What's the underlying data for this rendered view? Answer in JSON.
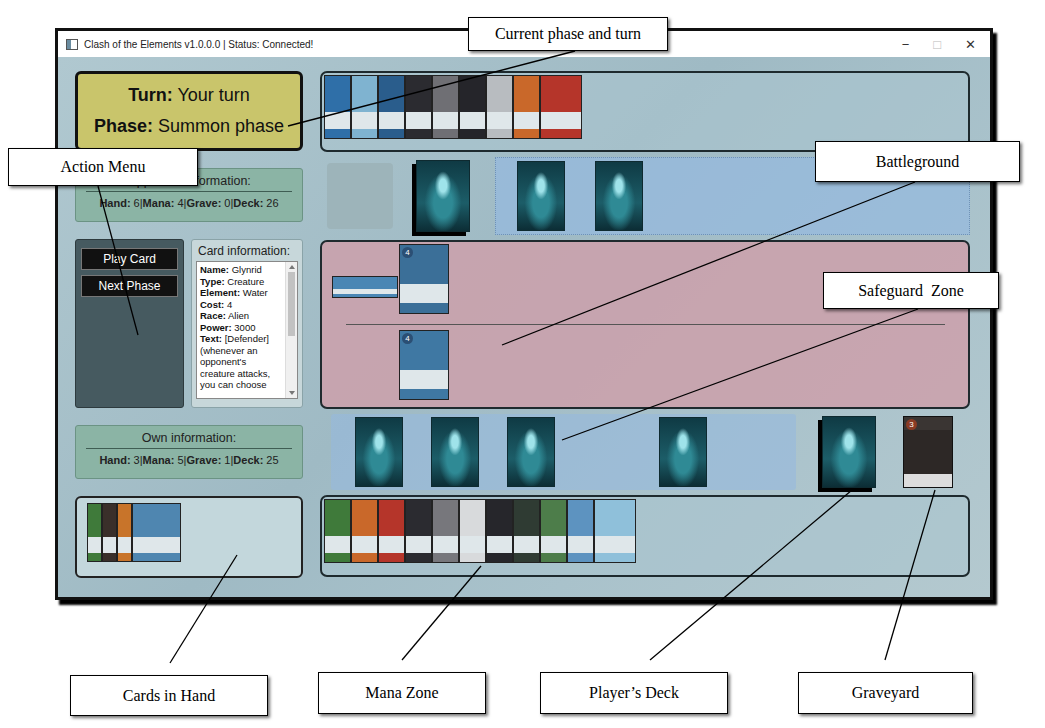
{
  "window": {
    "title": "Clash of the Elements v1.0.0.0 | Status: Connected!",
    "controls": [
      {
        "glyph": "−",
        "disabled": false
      },
      {
        "glyph": "□",
        "disabled": true
      },
      {
        "glyph": "✕",
        "disabled": false
      }
    ]
  },
  "turn_panel": {
    "turn_label": "Turn:",
    "turn": "Your turn",
    "phase_label": "Phase:",
    "phase": "Summon phase"
  },
  "opponent_info": {
    "title": "Opponent information:",
    "separator": "|",
    "stats": [
      {
        "label": "Hand:",
        "value": "6"
      },
      {
        "label": "Mana:",
        "value": "4"
      },
      {
        "label": "Grave:",
        "value": "0"
      },
      {
        "label": "Deck:",
        "value": "26"
      }
    ]
  },
  "own_info": {
    "title": "Own information:",
    "separator": "|",
    "stats": [
      {
        "label": "Hand:",
        "value": "3"
      },
      {
        "label": "Mana:",
        "value": "5"
      },
      {
        "label": "Grave:",
        "value": "1"
      },
      {
        "label": "Deck:",
        "value": "25"
      }
    ]
  },
  "action_menu": {
    "buttons": [
      {
        "label": "Play Card"
      },
      {
        "label": "Next Phase"
      }
    ]
  },
  "card_info": {
    "title": "Card information:",
    "fields": [
      {
        "label": "Name:",
        "value": "Glynrid"
      },
      {
        "label": "Type:",
        "value": "Creature"
      },
      {
        "label": "Element:",
        "value": "Water"
      },
      {
        "label": "Cost:",
        "value": "4"
      },
      {
        "label": "Race:",
        "value": "Alien"
      },
      {
        "label": "Power:",
        "value": "3000"
      },
      {
        "label": "Text:",
        "value": "[Defender] (whenever an opponent's creature attacks, you can choose"
      }
    ],
    "scrollbar": {
      "level": 0.55
    }
  },
  "opponent_mana": {
    "cards": [
      {
        "color": "#2f6fa8"
      },
      {
        "color": "#7fb3d0"
      },
      {
        "color": "#2a5d8c"
      },
      {
        "color": "#2b2b30"
      },
      {
        "color": "#6f6f74"
      },
      {
        "color": "#25252a"
      },
      {
        "color": "#b8bcc0"
      },
      {
        "color": "#c9682a"
      },
      {
        "color": "#b5352a"
      }
    ]
  },
  "opponent_safeguard": {
    "slots": [
      {
        "filled": true
      },
      {
        "filled": true
      }
    ]
  },
  "battleground": {
    "opponent_cards": [
      {
        "kind": "tapped",
        "color": "#4a86b4"
      },
      {
        "kind": "upright",
        "color": "#3b6f98",
        "cost": "4"
      }
    ],
    "own_cards": [
      {
        "kind": "upright",
        "color": "#3f78a3",
        "cost": "4"
      }
    ]
  },
  "own_safeguard": {
    "slots": [
      {
        "filled": true
      },
      {
        "filled": true
      },
      {
        "filled": true
      },
      {
        "filled": false
      },
      {
        "filled": true
      }
    ]
  },
  "graveyard": {
    "top_card": {
      "color": "#2d2826",
      "cost": "3"
    }
  },
  "hand": {
    "cards": [
      {
        "color": "#3f7a3a"
      },
      {
        "color": "#3a2f2a"
      },
      {
        "color": "#c8742a"
      },
      {
        "color": "#4f86b0"
      }
    ]
  },
  "own_mana": {
    "cards": [
      {
        "color": "#3f7a3a"
      },
      {
        "color": "#c9682a"
      },
      {
        "color": "#b5352a"
      },
      {
        "color": "#2b2b30"
      },
      {
        "color": "#77777c"
      },
      {
        "color": "#d8dadc"
      },
      {
        "color": "#26262b"
      },
      {
        "color": "#2f3b33"
      },
      {
        "color": "#4d7d4a"
      },
      {
        "color": "#5d93c0"
      },
      {
        "color": "#8fc0da"
      }
    ]
  },
  "callouts": [
    {
      "label": "Current phase and turn"
    },
    {
      "label": "Action Menu"
    },
    {
      "label": "Battleground"
    },
    {
      "label": "Safeguard  Zone"
    },
    {
      "label": "Cards in Hand"
    },
    {
      "label": "Mana Zone"
    },
    {
      "label": "Player’s Deck"
    },
    {
      "label": "Graveyard"
    }
  ]
}
